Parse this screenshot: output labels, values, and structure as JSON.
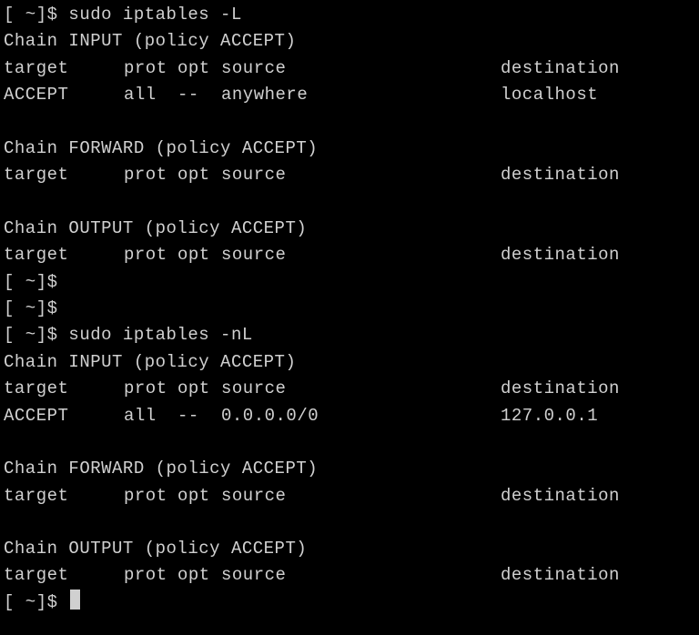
{
  "prompt": "[ ~]$ ",
  "cmd1": "sudo iptables -L",
  "cmd2": "sudo iptables -nL",
  "chains": {
    "input": "Chain INPUT (policy ACCEPT)",
    "forward": "Chain FORWARD (policy ACCEPT)",
    "output": "Chain OUTPUT (policy ACCEPT)"
  },
  "header": {
    "target": "target",
    "prot": "prot",
    "opt": "opt",
    "source": "source",
    "destination": "destination"
  },
  "rule1": {
    "target": "ACCEPT",
    "prot": "all",
    "opt": "--",
    "source": "anywhere",
    "destination": "localhost"
  },
  "rule2": {
    "target": "ACCEPT",
    "prot": "all",
    "opt": "--",
    "source": "0.0.0.0/0",
    "destination": "127.0.0.1"
  }
}
